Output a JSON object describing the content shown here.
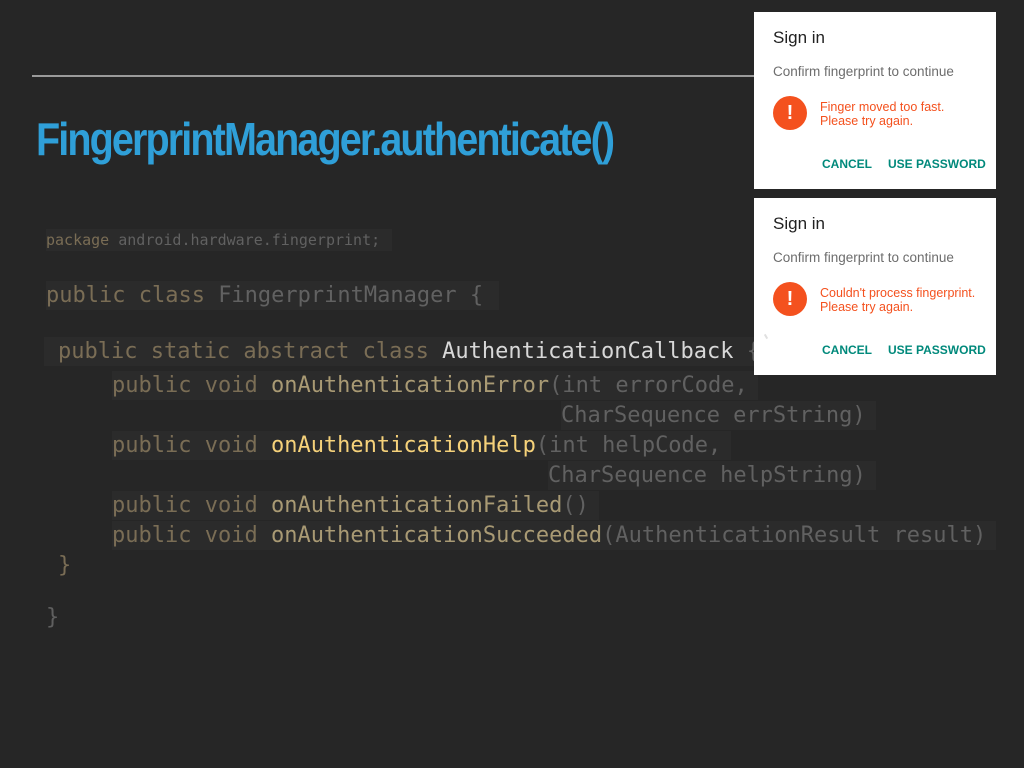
{
  "slide": {
    "title": "FingerprintManager.authenticate()"
  },
  "code": {
    "package_line": {
      "kw": "package",
      "name": " android.hardware.fingerprint",
      "end": ";"
    },
    "class_line": {
      "kw": "public class ",
      "name": "FingerprintManager",
      "brace": " {"
    },
    "inner_class_line": {
      "kw": "public static abstract class ",
      "name": "AuthenticationCallback",
      "brace": " {"
    },
    "methods": [
      {
        "kw": "public void ",
        "name": "onAuthenticationError",
        "params": "(int errorCode,",
        "cont": "CharSequence errString)"
      },
      {
        "kw": "public void ",
        "name": "onAuthenticationHelp",
        "params": "(int helpCode,",
        "cont": "CharSequence helpString)"
      },
      {
        "kw": "public void ",
        "name": "onAuthenticationFailed",
        "params": "()"
      },
      {
        "kw": "public void ",
        "name": "onAuthenticationSucceeded",
        "params": "(AuthenticationResult result)"
      }
    ],
    "inner_close": "}",
    "outer_close": "}"
  },
  "dialogs": [
    {
      "title": "Sign in",
      "subtitle": "Confirm fingerprint to continue",
      "icon": "error-icon",
      "icon_glyph": "!",
      "message": "Finger moved too fast. Please try again.",
      "cancel_label": "CANCEL",
      "password_label": "USE PASSWORD"
    },
    {
      "title": "Sign in",
      "subtitle": "Confirm fingerprint to continue",
      "icon": "error-icon",
      "icon_glyph": "!",
      "message": "Couldn't process fingerprint. Please try again.",
      "cancel_label": "CANCEL",
      "password_label": "USE PASSWORD"
    }
  ],
  "colors": {
    "background": "#262626",
    "title": "#2f9fd8",
    "error": "#f4511e",
    "button": "#00897b",
    "highlight": "#f6d27a"
  }
}
